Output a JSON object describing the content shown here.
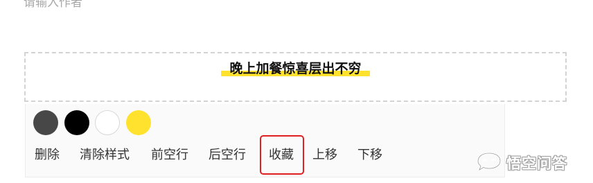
{
  "author": {
    "placeholder": "请输入作者",
    "value": ""
  },
  "title": {
    "text": "晚上加餐惊喜层出不穷",
    "highlight_color": "#ffe22e"
  },
  "toolbar": {
    "swatches": [
      {
        "name": "dark-gray",
        "color": "#474747"
      },
      {
        "name": "black",
        "color": "#000000"
      },
      {
        "name": "white",
        "color": "#ffffff"
      },
      {
        "name": "yellow",
        "color": "#ffe22e"
      }
    ],
    "actions": {
      "delete": "删除",
      "clear_style": "清除样式",
      "space_before": "前空行",
      "space_after": "后空行",
      "favorite": "收藏",
      "move_up": "上移",
      "move_down": "下移"
    },
    "highlighted_action": "favorite",
    "highlight_color": "#e02020"
  },
  "watermark": {
    "text": "悟空问答",
    "icon": "chat-bubble-eyes-icon"
  }
}
